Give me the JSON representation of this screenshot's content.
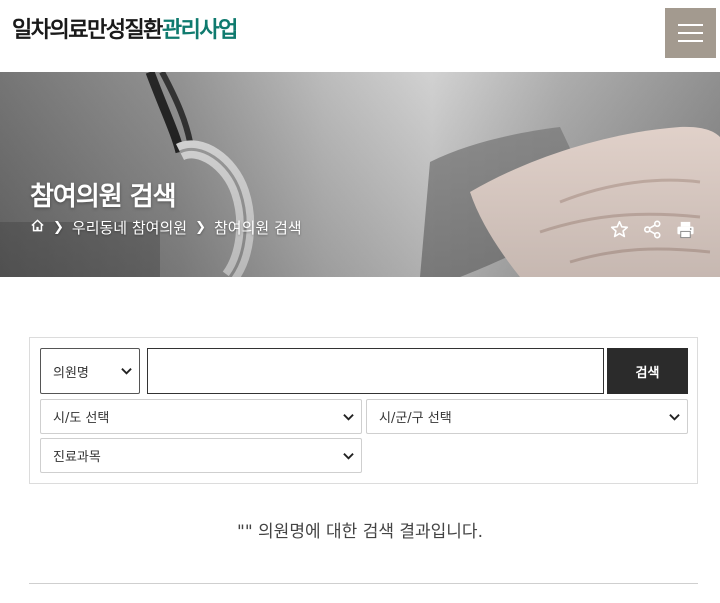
{
  "header": {
    "logo_part1": "일차의료만성질환",
    "logo_part2": "관리사업",
    "menu_icon": "hamburger-menu-icon"
  },
  "hero": {
    "title": "참여의원 검색",
    "breadcrumb": {
      "home_icon": "home-icon",
      "items": [
        "우리동네 참여의원",
        "참여의원 검색"
      ]
    },
    "tools": [
      "star-icon",
      "share-icon",
      "print-icon"
    ]
  },
  "search": {
    "type_select": "의원명",
    "keyword_value": "",
    "button_label": "검색",
    "sido_select": "시/도 선택",
    "sigungu_select": "시/군/구 선택",
    "dept_select": "진료과목"
  },
  "result": {
    "message": "\"\" 의원명에 대한 검색 결과입니다."
  },
  "colors": {
    "brand_green": "#0f7a6e",
    "menu_button": "#a39a8f",
    "search_button": "#2b2b2b"
  }
}
